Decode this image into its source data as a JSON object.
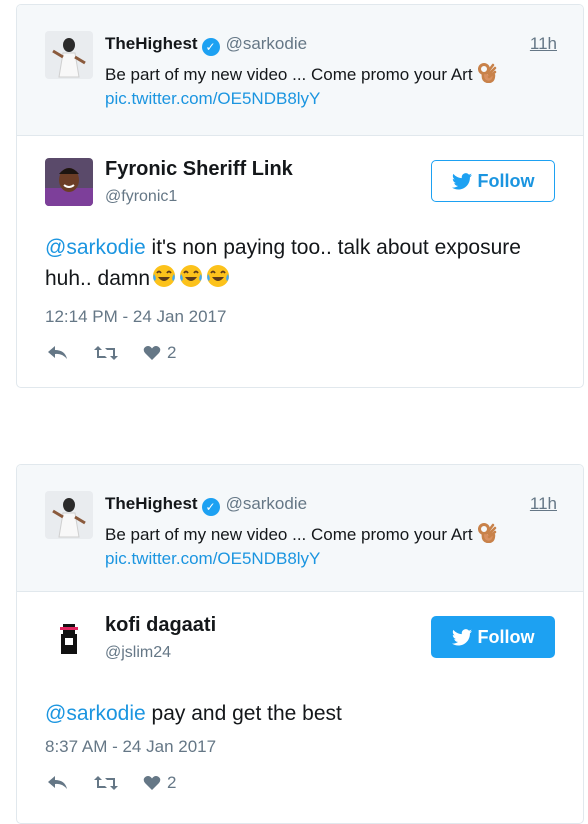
{
  "tweets": [
    {
      "quoted": {
        "name": "TheHighest",
        "handle": "@sarkodie",
        "time": "11h",
        "text": "Be part of my new video ... Come promo your Art",
        "link": "pic.twitter.com/OE5NDB8lyY"
      },
      "author": {
        "name": "Fyronic Sheriff Link",
        "handle": "@fyronic1"
      },
      "follow_label": "Follow",
      "mention": "@sarkodie",
      "text": " it's non paying too.. talk about exposure huh.. damn",
      "timestamp": "12:14 PM - 24 Jan 2017",
      "likes": "2"
    },
    {
      "quoted": {
        "name": "TheHighest",
        "handle": "@sarkodie",
        "time": "11h",
        "text": "Be part of my new video ... Come promo your Art",
        "link": "pic.twitter.com/OE5NDB8lyY"
      },
      "author": {
        "name": "kofi dagaati",
        "handle": "@jslim24"
      },
      "follow_label": "Follow",
      "mention": "@sarkodie",
      "text": " pay and get the best",
      "timestamp": "8:37 AM - 24 Jan 2017",
      "likes": "2"
    }
  ],
  "colors": {
    "link": "#1b95e0",
    "accent": "#1da1f2",
    "muted": "#657786"
  }
}
